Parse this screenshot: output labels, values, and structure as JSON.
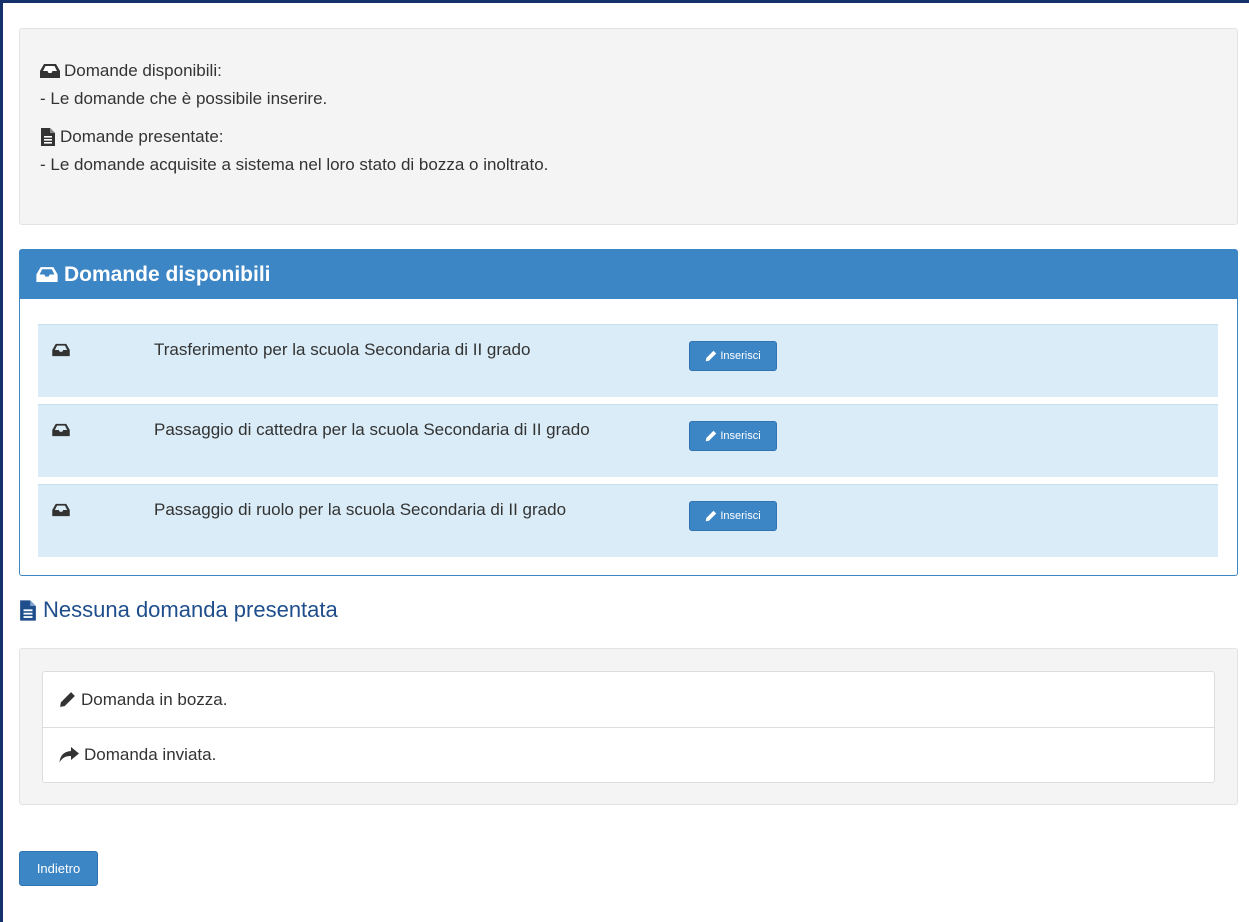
{
  "info": {
    "available_label": "Domande disponibili:",
    "available_desc": "- Le domande che è possibile inserire.",
    "submitted_label": "Domande presentate:",
    "submitted_desc": "- Le domande acquisite a sistema nel loro stato di bozza o inoltrato.",
    "available_icon": "inbox-icon",
    "submitted_icon": "file-text-icon"
  },
  "panel": {
    "title": "Domande disponibili",
    "icon": "inbox-icon",
    "rows": [
      {
        "text": "Trasferimento per la scuola Secondaria di II grado",
        "button": "Inserisci"
      },
      {
        "text": "Passaggio di cattedra per la scuola Secondaria di II grado",
        "button": "Inserisci"
      },
      {
        "text": "Passaggio di ruolo per la scuola Secondaria di II grado",
        "button": "Inserisci"
      }
    ]
  },
  "submitted_section": {
    "title": "Nessuna domanda presentata",
    "icon": "file-text-icon"
  },
  "legend": {
    "items": [
      {
        "icon": "pencil-icon",
        "text": "Domanda in bozza."
      },
      {
        "icon": "share-arrow-icon",
        "text": "Domanda inviata."
      }
    ]
  },
  "footer": {
    "back_button": "Indietro"
  },
  "colors": {
    "primary": "#3d86c6",
    "row_bg": "#d9ecf7",
    "well_bg": "#f4f4f4",
    "title_blue": "#1f4e8c"
  }
}
